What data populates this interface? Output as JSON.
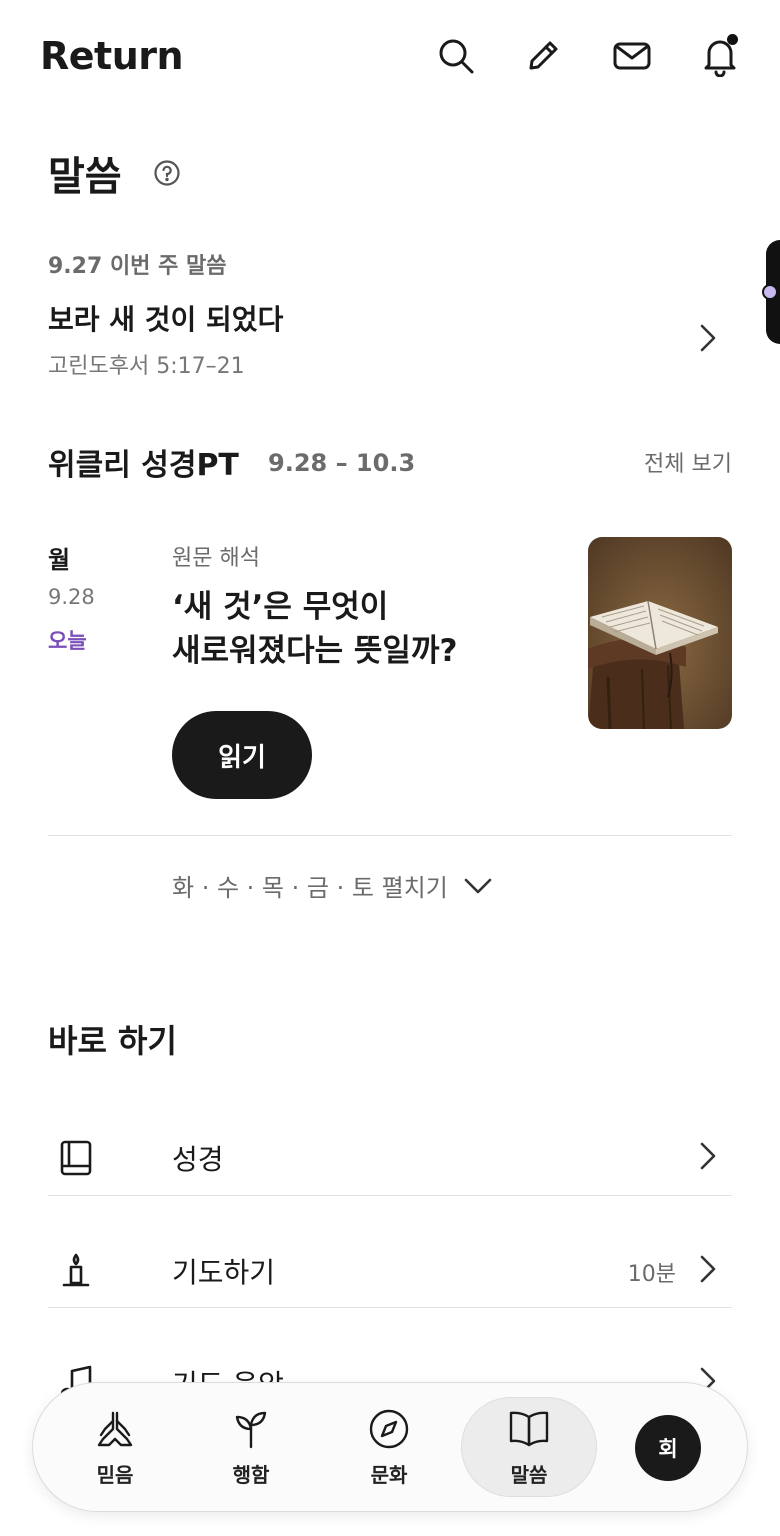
{
  "header": {
    "app_title": "Return",
    "icons": [
      "search-icon",
      "pencil-icon",
      "mail-icon",
      "bell-icon"
    ]
  },
  "page": {
    "title": "말씀"
  },
  "weekly_word": {
    "subtitle": "9.27 이번 주 말씀",
    "title": "보라 새 것이 되었다",
    "reference": "고린도후서 5:17–21"
  },
  "weekly_pt": {
    "title": "위클리 성경PT",
    "range": "9.28 – 10.3",
    "view_all": "전체 보기",
    "day": {
      "name": "월",
      "date": "9.28",
      "today": "오늘"
    },
    "article": {
      "category": "원문 해석",
      "title_line1": "‘새 것’은 무엇이",
      "title_line2": "새로워졌다는 뜻일까?",
      "read_button": "읽기",
      "thumbnail": "open-bible-on-stump"
    },
    "expand_label": "화 · 수 · 목 · 금 · 토 펼치기"
  },
  "quick": {
    "title": "바로 하기",
    "items": [
      {
        "icon": "book-icon",
        "label": "성경",
        "meta": ""
      },
      {
        "icon": "candle-icon",
        "label": "기도하기",
        "meta": "10분"
      },
      {
        "icon": "music-note-icon",
        "label": "기도 음악",
        "meta": ""
      }
    ]
  },
  "tabbar": {
    "tabs": [
      {
        "icon": "praying-hands-icon",
        "label": "믿음"
      },
      {
        "icon": "sprout-icon",
        "label": "행함"
      },
      {
        "icon": "compass-icon",
        "label": "문화"
      },
      {
        "icon": "open-book-icon",
        "label": "말씀"
      }
    ],
    "active_tab": "말씀",
    "avatar": "회"
  },
  "colors": {
    "accent_purple": "#7a4fb8",
    "dark": "#1a1a1a"
  }
}
